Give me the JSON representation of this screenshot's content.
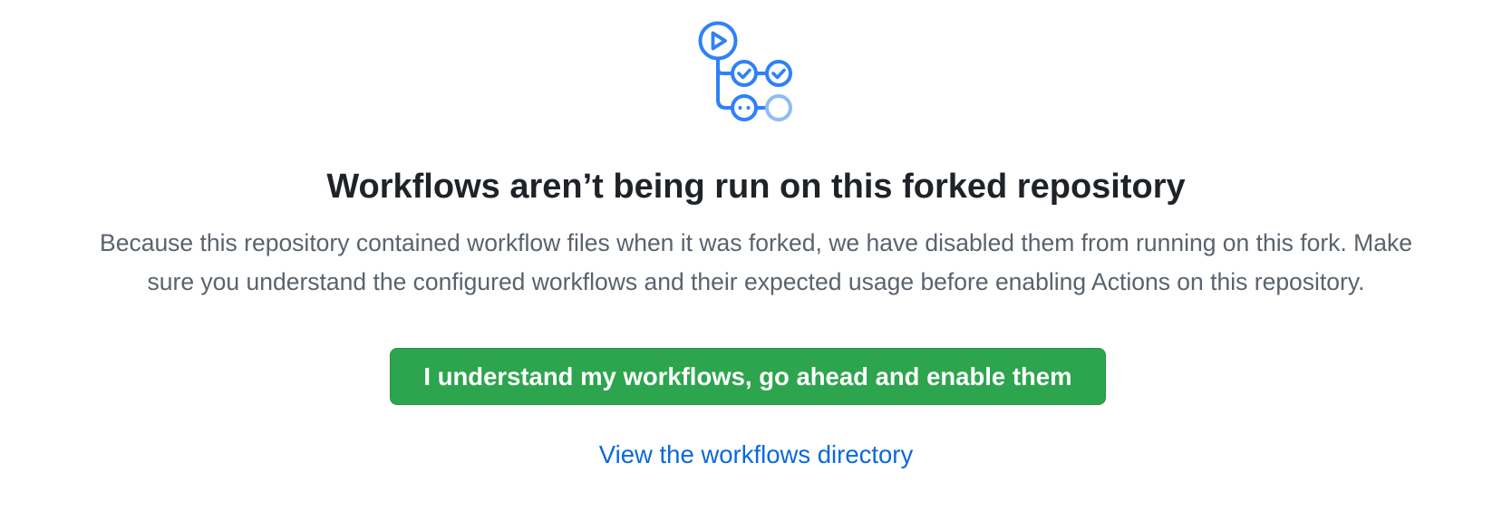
{
  "icon": {
    "name": "actions-workflow-icon",
    "primary_color": "#2f81f7",
    "muted_color": "#8fbcf7"
  },
  "title": "Workflows aren’t being run on this forked repository",
  "description": {
    "line1": "Because this repository contained workflow files when it was forked, we have disabled them from running on this fork. Make",
    "line2": "sure you understand the configured workflows and their expected usage before enabling Actions on this repository."
  },
  "enable_button": {
    "label": "I understand my workflows, go ahead and enable them",
    "color": "#2da44e"
  },
  "workflows_link": {
    "label": "View the workflows directory",
    "color": "#0969da"
  }
}
